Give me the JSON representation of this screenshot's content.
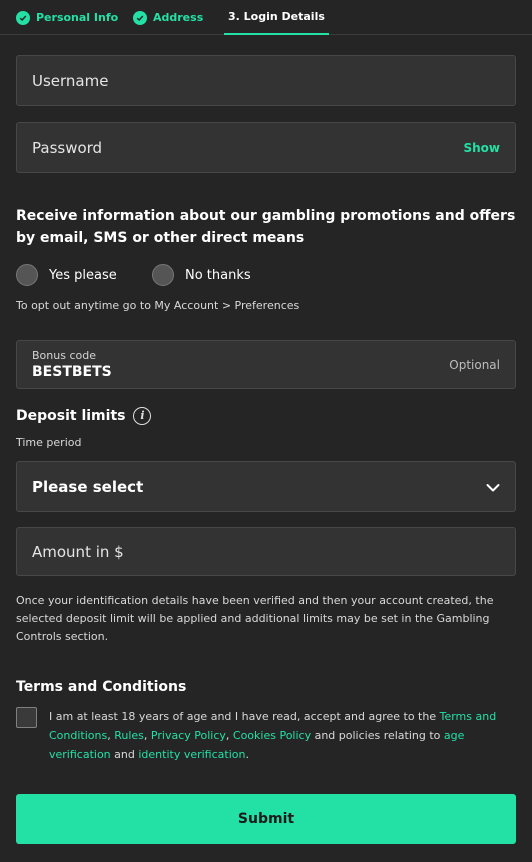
{
  "colors": {
    "accent": "#23e0a5",
    "background": "#252525",
    "field": "#333333"
  },
  "stepper": {
    "steps": [
      {
        "label": "Personal Info",
        "state": "done",
        "icon": "check-circle-icon"
      },
      {
        "label": "Address",
        "state": "done",
        "icon": "check-circle-icon"
      },
      {
        "label": "3. Login Details",
        "state": "active"
      }
    ]
  },
  "username": {
    "placeholder": "Username"
  },
  "password": {
    "placeholder": "Password",
    "show_label": "Show"
  },
  "marketing": {
    "question": "Receive information about our gambling promotions and offers by email, SMS or other direct means",
    "options": [
      {
        "label": "Yes please"
      },
      {
        "label": "No thanks"
      }
    ],
    "opt_out_note": "To opt out anytime go to My Account > Preferences"
  },
  "bonus": {
    "label": "Bonus code",
    "value": "BESTBETS",
    "optional_label": "Optional"
  },
  "deposit": {
    "heading": "Deposit limits",
    "info_icon": "info-icon",
    "time_period_label": "Time period",
    "select_value": "Please select",
    "amount_placeholder": "Amount in $",
    "note": "Once your identification details have been verified and then your account created, the selected deposit limit will be applied and additional limits may be set in the Gambling Controls section."
  },
  "terms": {
    "heading": "Terms and Conditions",
    "text_1": "I am at least 18 years of age and I have read, accept and agree to the ",
    "link_terms": "Terms and Conditions",
    "sep_1": ", ",
    "link_rules": "Rules",
    "sep_2": ", ",
    "link_privacy": "Privacy Policy",
    "sep_3": ", ",
    "link_cookies": "Cookies Policy",
    "text_2": " and policies relating to ",
    "link_age": "age verification",
    "text_3": " and ",
    "link_identity": "identity verification",
    "text_4": "."
  },
  "submit_label": "Submit"
}
